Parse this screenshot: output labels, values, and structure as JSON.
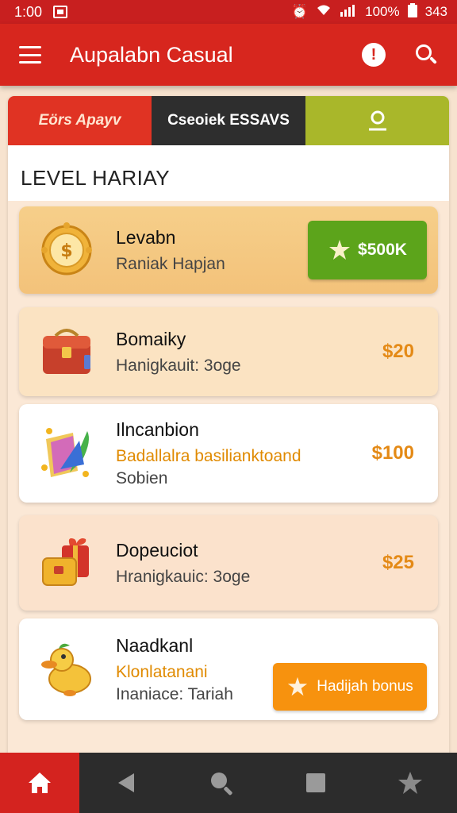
{
  "status_bar": {
    "time": "1:00",
    "battery_percent": "100%",
    "extra": "343"
  },
  "app_bar": {
    "title": "Aupalabn Casual",
    "icons": [
      "menu-icon",
      "info-icon",
      "search-icon"
    ]
  },
  "tabs": [
    {
      "label": "Eörs Apayv"
    },
    {
      "label": "Cseoiek ESSAVS"
    },
    {
      "label": "",
      "icon": "user-icon"
    }
  ],
  "section_title": "LEVEL HARIAY",
  "items": [
    {
      "name": "Levabn",
      "sub": "Raniak Hapjan",
      "button": "$500K",
      "icon": "coin-clock-icon"
    },
    {
      "name": "Bomaiky",
      "sub": "Hanigkauit: 3oge",
      "price": "$20",
      "icon": "treasure-chest-icon"
    },
    {
      "name": "Ilncanbion",
      "accent": "Badallalra basilianktoand",
      "sub": "Sobien",
      "price": "$100",
      "icon": "magic-book-icon"
    },
    {
      "name": "Dopeuciot",
      "sub": "Hranigkauic: 3oge",
      "price": "$25",
      "icon": "gift-box-icon"
    },
    {
      "name": "Naadkanl",
      "accent": "Klonlatanani",
      "sub": "Inaniace: Tariah",
      "button": "Hadijah bonus",
      "icon": "duck-icon"
    }
  ],
  "colors": {
    "primary_red": "#d7261e",
    "button_green": "#5ca41b",
    "button_orange": "#f7920e",
    "price_orange": "#e48a16"
  },
  "nav": [
    "home-icon",
    "back-icon",
    "search-icon",
    "square-icon",
    "star-icon"
  ]
}
